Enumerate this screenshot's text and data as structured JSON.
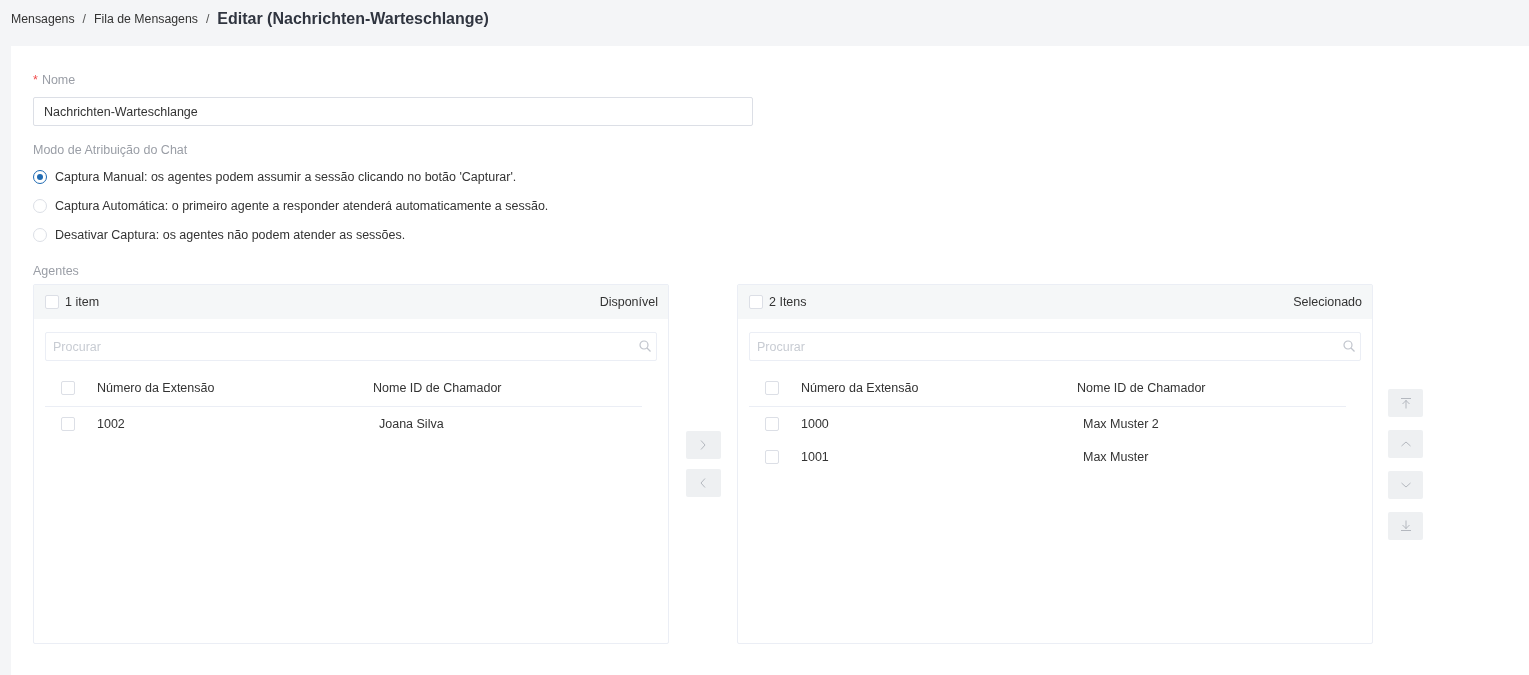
{
  "breadcrumb": [
    {
      "kind": "link",
      "label": "Mensagens"
    },
    {
      "kind": "separator",
      "label": "/"
    },
    {
      "kind": "link",
      "label": "Fila de Mensagens"
    },
    {
      "kind": "separator",
      "label": "/"
    },
    {
      "kind": "current",
      "label": "Editar (Nachrichten-Warteschlange)"
    }
  ],
  "name_field": {
    "required_mark": "*",
    "label": "Nome",
    "value": "Nachrichten-Warteschlange"
  },
  "assignment_mode": {
    "label": "Modo de Atribuição do Chat",
    "options": [
      {
        "label": "Captura Manual: os agentes podem assumir a sessão clicando no botão 'Capturar'.",
        "selected": true
      },
      {
        "label": "Captura Automática: o primeiro agente a responder atenderá automaticamente a sessão.",
        "selected": false
      },
      {
        "label": "Desativar Captura: os agentes não podem atender as sessões.",
        "selected": false
      }
    ]
  },
  "agents": {
    "label": "Agentes",
    "available": {
      "all_checked": false,
      "count": "1 item",
      "title": "Disponível",
      "search": {
        "placeholder": "Procurar"
      },
      "table": {
        "header_checked": false,
        "columns": [
          "Número da Extensão",
          "Nome ID de Chamador"
        ],
        "rows": [
          {
            "checked": false,
            "cells": [
              "1002",
              "Joana Silva"
            ]
          }
        ]
      }
    },
    "transfer_buttons": [
      {
        "kind": "right",
        "disabled": true
      },
      {
        "kind": "left",
        "disabled": true
      }
    ],
    "selected": {
      "all_checked": false,
      "count": "2 Itens",
      "title": "Selecionado",
      "search": {
        "placeholder": "Procurar"
      },
      "table": {
        "header_checked": false,
        "columns": [
          "Número da Extensão",
          "Nome ID de Chamador"
        ],
        "rows": [
          {
            "checked": false,
            "cells": [
              "1000",
              "Max Muster 2"
            ]
          },
          {
            "checked": false,
            "cells": [
              "1001",
              "Max Muster"
            ]
          }
        ]
      }
    },
    "order_buttons": [
      {
        "kind": "top",
        "disabled": true
      },
      {
        "kind": "up",
        "disabled": true
      },
      {
        "kind": "down",
        "disabled": true
      },
      {
        "kind": "bottom",
        "disabled": true
      }
    ]
  }
}
